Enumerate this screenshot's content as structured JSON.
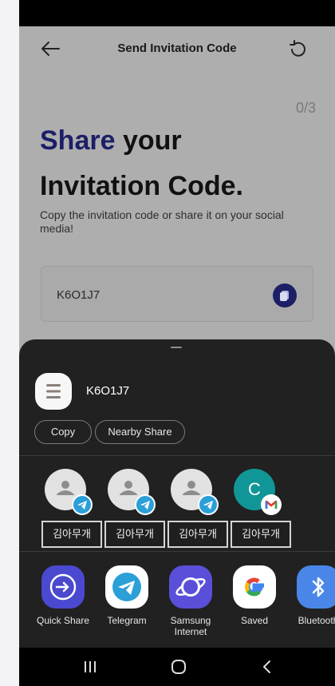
{
  "header": {
    "title": "Send Invitation Code",
    "back_icon": "arrow-left-icon",
    "refresh_icon": "refresh-icon"
  },
  "page": {
    "step_counter": "0/3",
    "headline_accent": "Share",
    "headline_rest": " your",
    "headline_line2": "Invitation Code.",
    "subtitle": "Copy the invitation code or share it on your social media!",
    "invite_code": "K6O1J7",
    "accent_color": "#1c1f66"
  },
  "share_sheet": {
    "preview_text": "K6O1J7",
    "actions": [
      "Copy",
      "Nearby Share"
    ],
    "contacts": [
      {
        "name": "김아무개",
        "avatar_letter": "",
        "badge": "telegram-icon"
      },
      {
        "name": "김아무개",
        "avatar_letter": "",
        "badge": "telegram-icon"
      },
      {
        "name": "김아무개",
        "avatar_letter": "",
        "badge": "telegram-icon"
      },
      {
        "name": "김아무개",
        "avatar_letter": "C",
        "badge": "gmail-icon"
      }
    ],
    "apps": [
      {
        "label": "Quick Share",
        "icon": "quick-share-icon"
      },
      {
        "label": "Telegram",
        "icon": "telegram-icon"
      },
      {
        "label": "Samsung Internet",
        "icon": "samsung-internet-icon"
      },
      {
        "label": "Saved",
        "icon": "google-icon"
      },
      {
        "label": "Bluetooth",
        "icon": "bluetooth-icon"
      }
    ]
  },
  "nav": {
    "recents": "recents-icon",
    "home": "home-icon",
    "back": "back-icon"
  }
}
